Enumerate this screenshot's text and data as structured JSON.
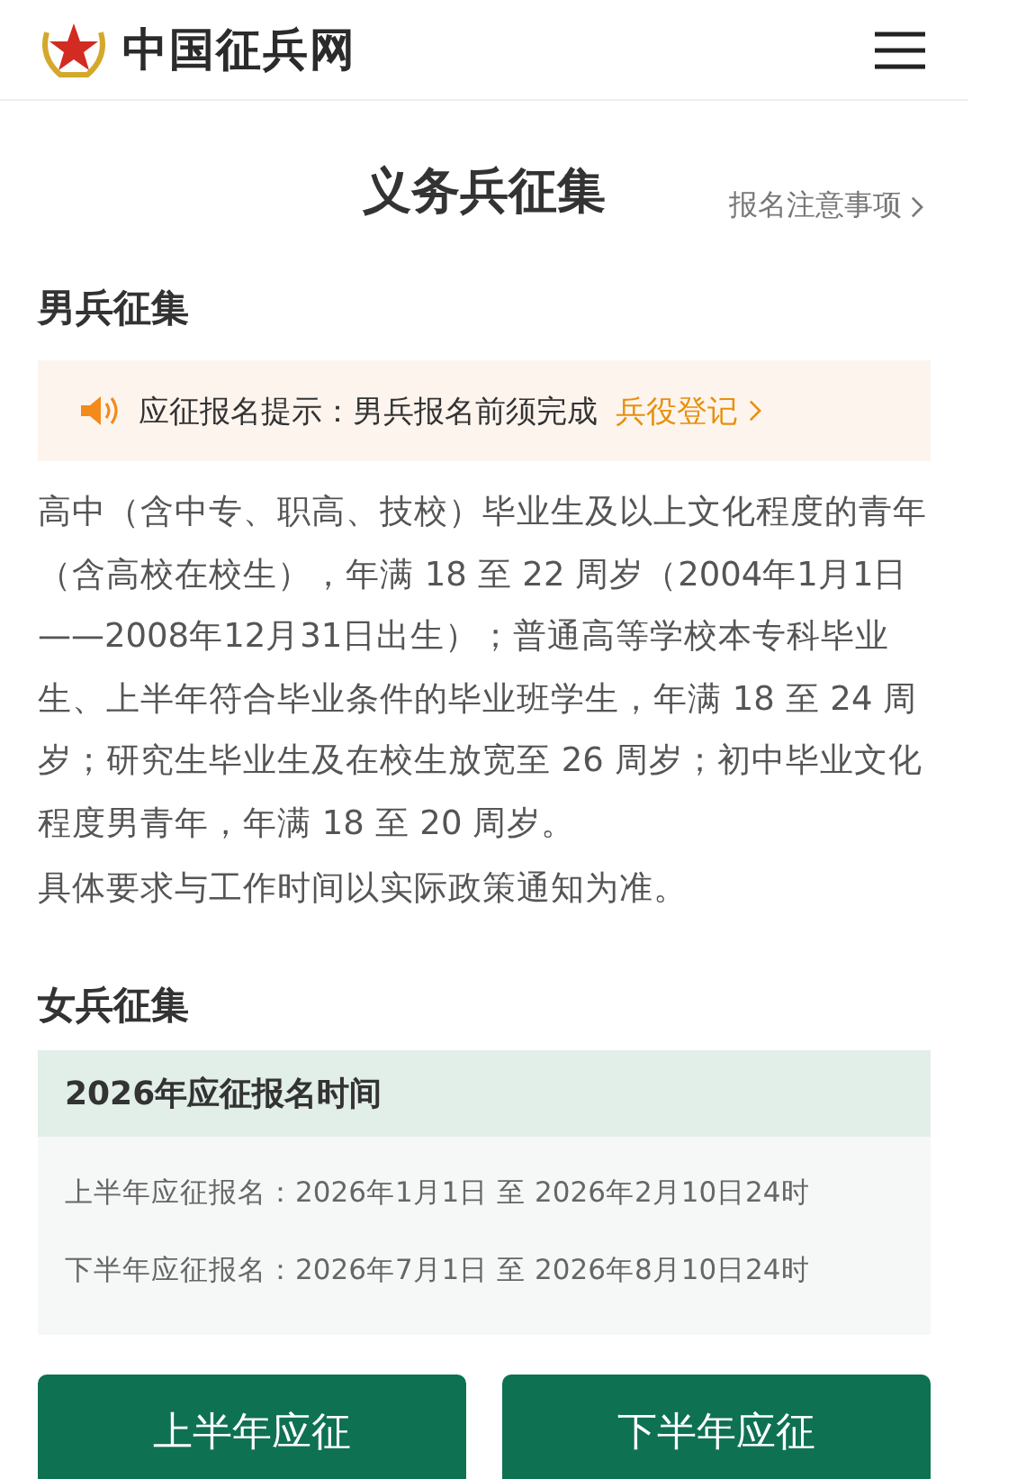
{
  "header": {
    "site_name": "中国征兵网"
  },
  "page": {
    "title": "义务兵征集",
    "notice_link": "报名注意事项"
  },
  "male": {
    "heading": "男兵征集",
    "tip_label": "应征报名提示：男兵报名前须完成",
    "tip_link": "兵役登记",
    "paragraphs": [
      "高中（含中专、职高、技校）毕业生及以上文化程度的青年（含高校在校生），年满 18 至 22 周岁（2004年1月1日——2008年12月31日出生）；普通高等学校本专科毕业生、上半年符合毕业条件的毕业班学生，年满 18 至 24 周岁；研究生毕业生及在校生放宽至 26 周岁；初中毕业文化程度男青年，年满 18 至 20 周岁。",
      "具体要求与工作时间以实际政策通知为准。"
    ]
  },
  "female": {
    "heading": "女兵征集",
    "card_title": "2026年应征报名时间",
    "rows": [
      "上半年应征报名：2026年1月1日 至 2026年2月10日24时",
      "下半年应征报名：2026年7月1日 至 2026年8月10日24时"
    ]
  },
  "buttons": [
    "上半年应征",
    "下半年应征"
  ]
}
